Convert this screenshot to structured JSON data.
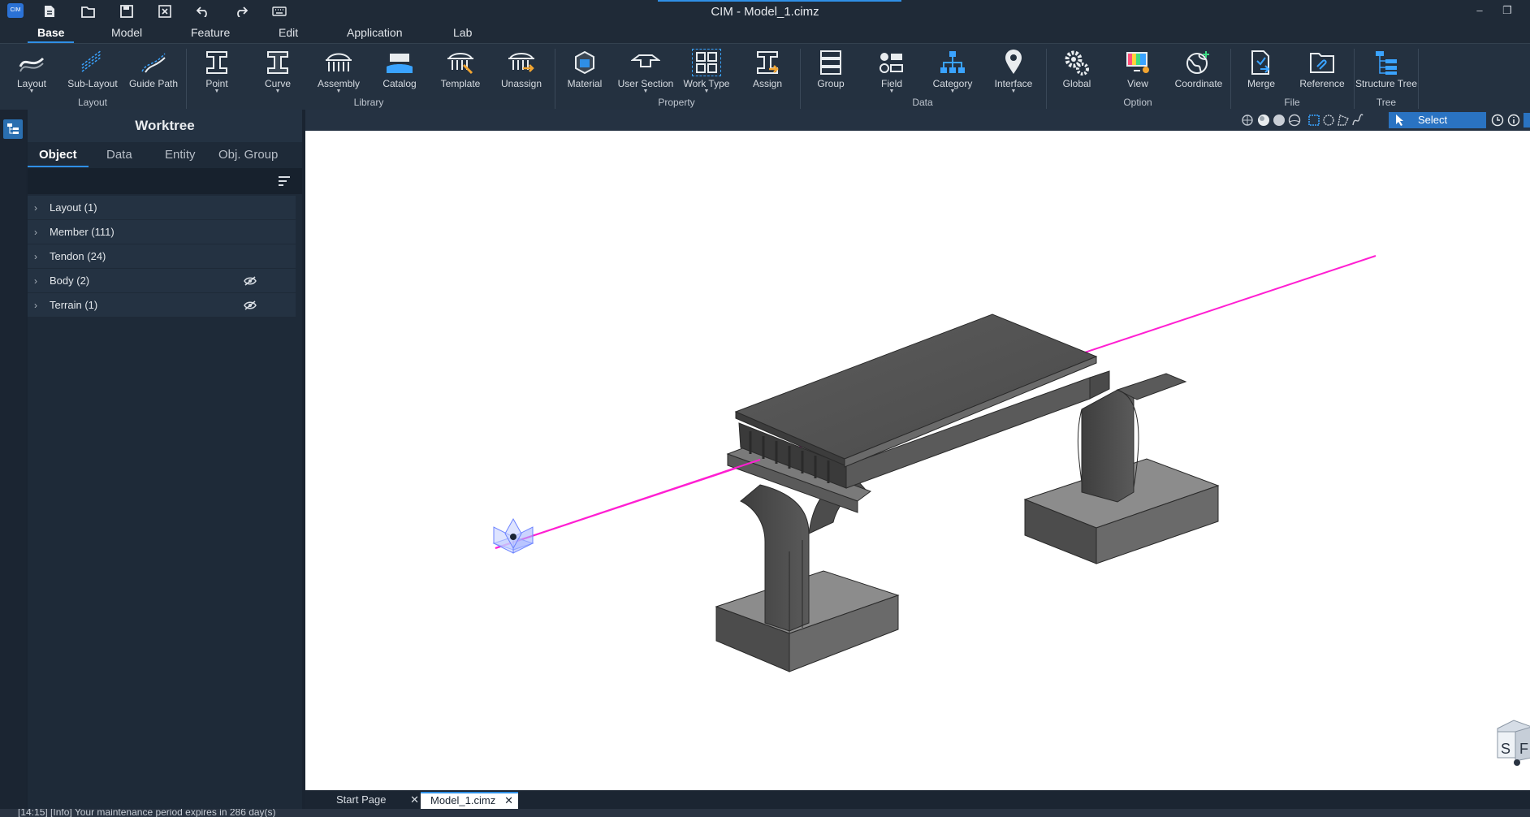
{
  "app": {
    "title": "CIM - Model_1.cimz",
    "logo_text": "CIM"
  },
  "quick_access": [
    "new-file-icon",
    "open-folder-icon",
    "save-icon",
    "close-file-icon",
    "undo-icon",
    "redo-icon",
    "keyboard-icon"
  ],
  "menu_tabs": [
    {
      "label": "Base",
      "active": true
    },
    {
      "label": "Model",
      "active": false
    },
    {
      "label": "Feature",
      "active": false
    },
    {
      "label": "Edit",
      "active": false
    },
    {
      "label": "Application",
      "active": false
    },
    {
      "label": "Lab",
      "active": false
    }
  ],
  "ribbon": {
    "buttons": [
      {
        "label": "Layout",
        "icon": "layout-curve-icon",
        "dropdown": true
      },
      {
        "label": "Sub-Layout",
        "icon": "sub-layout-icon",
        "dropdown": false
      },
      {
        "label": "Guide Path",
        "icon": "guide-path-icon",
        "dropdown": false
      },
      {
        "label": "Point",
        "icon": "point-section-icon",
        "dropdown": true
      },
      {
        "label": "Curve",
        "icon": "curve-section-icon",
        "dropdown": true
      },
      {
        "label": "Assembly",
        "icon": "assembly-icon",
        "dropdown": true
      },
      {
        "label": "Catalog",
        "icon": "catalog-icon",
        "dropdown": false
      },
      {
        "label": "Template",
        "icon": "template-icon",
        "dropdown": false
      },
      {
        "label": "Unassign",
        "icon": "unassign-icon",
        "dropdown": false
      },
      {
        "label": "Material",
        "icon": "material-cube-icon",
        "dropdown": false
      },
      {
        "label": "User Section",
        "icon": "user-section-icon",
        "dropdown": true
      },
      {
        "label": "Work Type",
        "icon": "work-type-icon",
        "dropdown": true
      },
      {
        "label": "Assign",
        "icon": "assign-icon",
        "dropdown": false
      },
      {
        "label": "Group",
        "icon": "group-icon",
        "dropdown": false
      },
      {
        "label": "Field",
        "icon": "field-icon",
        "dropdown": true
      },
      {
        "label": "Category",
        "icon": "category-icon",
        "dropdown": true
      },
      {
        "label": "Interface",
        "icon": "interface-pin-icon",
        "dropdown": true
      },
      {
        "label": "Global",
        "icon": "global-gears-icon",
        "dropdown": false
      },
      {
        "label": "View",
        "icon": "view-monitor-icon",
        "dropdown": false
      },
      {
        "label": "Coordinate",
        "icon": "coordinate-globe-icon",
        "dropdown": false
      },
      {
        "label": "Merge",
        "icon": "merge-file-icon",
        "dropdown": false
      },
      {
        "label": "Reference",
        "icon": "reference-link-icon",
        "dropdown": false
      },
      {
        "label": "Structure Tree",
        "icon": "structure-tree-icon",
        "dropdown": false
      }
    ],
    "groups": [
      "Layout",
      "Library",
      "Property",
      "Data",
      "Option",
      "File",
      "Tree"
    ]
  },
  "worktree": {
    "title": "Worktree",
    "tabs": [
      {
        "label": "Object",
        "active": true
      },
      {
        "label": "Data",
        "active": false
      },
      {
        "label": "Entity",
        "active": false
      },
      {
        "label": "Obj. Group",
        "active": false
      }
    ],
    "items": [
      {
        "label": "Layout (1)",
        "hidden": false
      },
      {
        "label": "Member (111)",
        "hidden": false
      },
      {
        "label": "Tendon (24)",
        "hidden": false
      },
      {
        "label": "Body (2)",
        "hidden": true
      },
      {
        "label": "Terrain (1)",
        "hidden": true
      }
    ]
  },
  "viewport": {
    "select_label": "Select",
    "layout_line_color": "#ff1fd2",
    "viewcube_labels": [
      "S",
      "F"
    ]
  },
  "document_tabs": [
    {
      "label": "Start Page",
      "active": false
    },
    {
      "label": "Model_1.cimz",
      "active": true
    }
  ],
  "status": {
    "message": "[14:15] [Info] Your maintenance period expires in 286 day(s)"
  }
}
